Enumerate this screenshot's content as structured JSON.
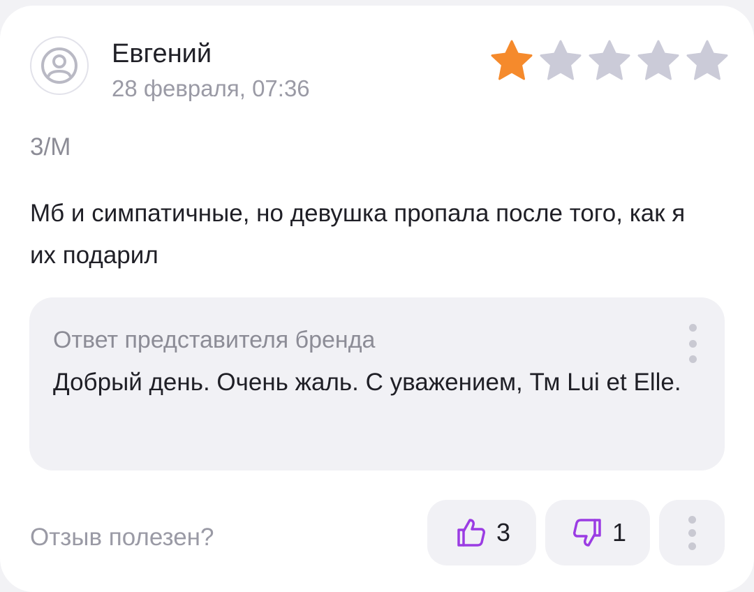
{
  "review": {
    "author": "Евгений",
    "date": "28 февраля, 07:36",
    "rating": 1,
    "rating_max": 5,
    "variant": "3/М",
    "text": "Мб и симпатичные, но девушка пропала после того, как я их подарил"
  },
  "brand_reply": {
    "title": "Ответ представителя бренда",
    "text": "Добрый день. Очень жаль. С уважением, Тм Lui et Elle."
  },
  "helpful": {
    "question": "Отзыв полезен?",
    "likes": "3",
    "dislikes": "1"
  },
  "colors": {
    "star_active": "#f58a2c",
    "star_inactive": "#cbcbd8",
    "accent": "#9b3ce3"
  },
  "icons": {
    "avatar": "user-icon",
    "like": "thumbs-up-icon",
    "dislike": "thumbs-down-icon",
    "menu": "more-vertical-icon"
  }
}
